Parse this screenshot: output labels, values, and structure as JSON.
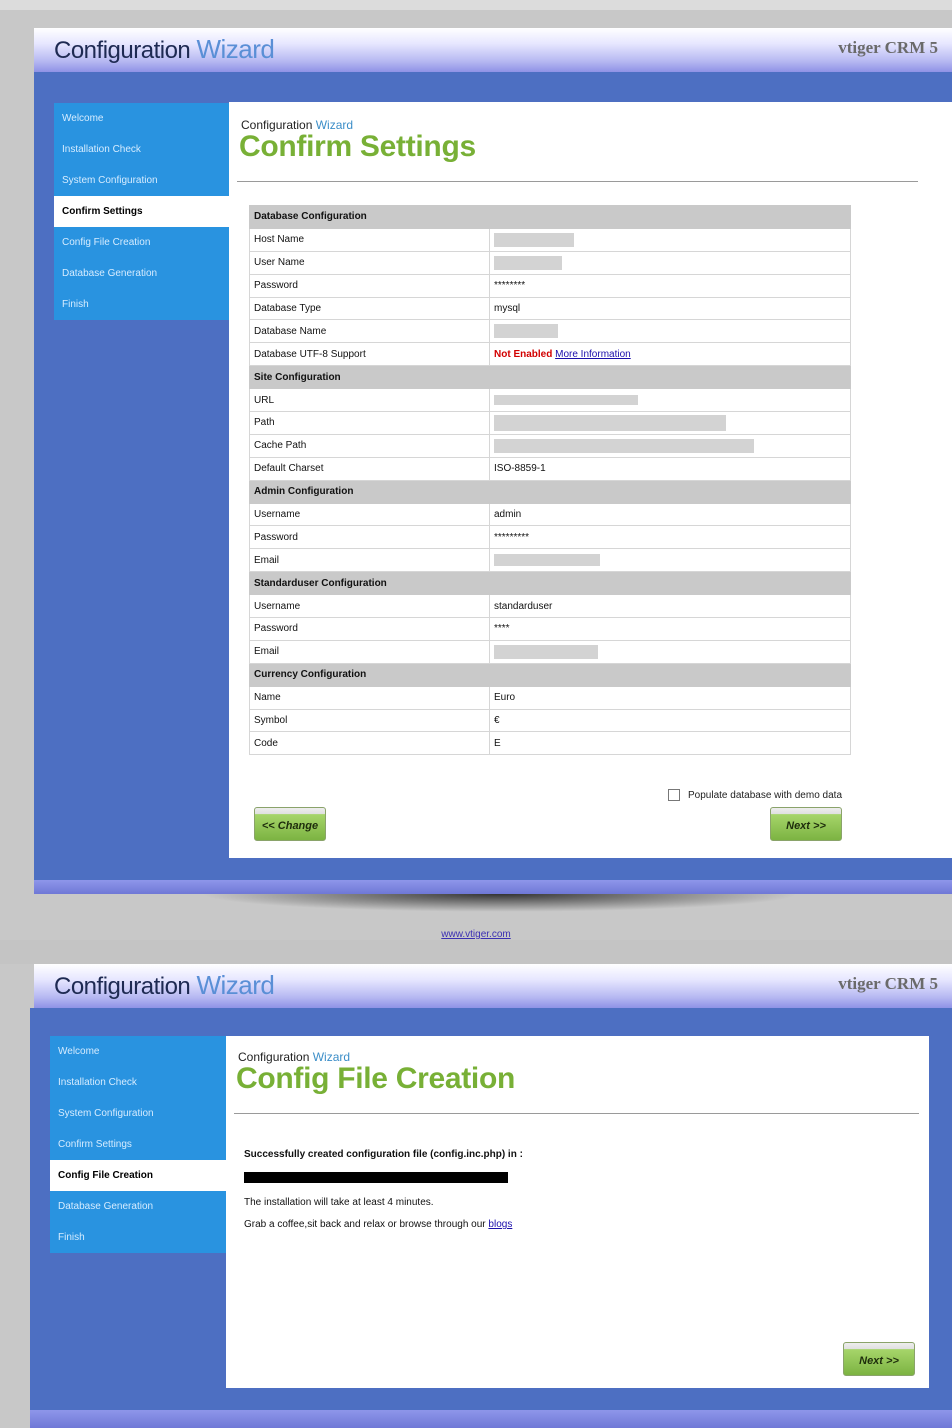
{
  "header": {
    "title_part1": "Configuration",
    "title_part2": "Wizard",
    "brand": "vtiger CRM 5"
  },
  "sidebar_confirm": {
    "items": [
      {
        "label": "Welcome"
      },
      {
        "label": "Installation Check"
      },
      {
        "label": "System Configuration"
      },
      {
        "label": "Confirm Settings",
        "active": true
      },
      {
        "label": "Config File Creation"
      },
      {
        "label": "Database Generation"
      },
      {
        "label": "Finish"
      }
    ]
  },
  "confirm": {
    "small_title_part1": "Configuration",
    "small_title_part2": "Wizard",
    "title": "Confirm Settings",
    "sections": [
      {
        "title": "Database Configuration",
        "rows": [
          {
            "label": "Host Name",
            "value": ""
          },
          {
            "label": "User Name",
            "value": ""
          },
          {
            "label": "Password",
            "value": "********"
          },
          {
            "label": "Database Type",
            "value": "mysql"
          },
          {
            "label": "Database Name",
            "value": ""
          },
          {
            "label": "Database UTF-8 Support",
            "value": "Not Enabled",
            "link": "More Information"
          }
        ]
      },
      {
        "title": "Site Configuration",
        "rows": [
          {
            "label": "URL",
            "value": ""
          },
          {
            "label": "Path",
            "value": ""
          },
          {
            "label": "Cache Path",
            "value": ""
          },
          {
            "label": "Default Charset",
            "value": "ISO-8859-1"
          }
        ]
      },
      {
        "title": "Admin Configuration",
        "rows": [
          {
            "label": "Username",
            "value": "admin"
          },
          {
            "label": "Password",
            "value": "*********"
          },
          {
            "label": "Email",
            "value": ""
          }
        ]
      },
      {
        "title": "Standarduser Configuration",
        "rows": [
          {
            "label": "Username",
            "value": "standarduser"
          },
          {
            "label": "Password",
            "value": "****"
          },
          {
            "label": "Email",
            "value": ""
          }
        ]
      },
      {
        "title": "Currency Configuration",
        "rows": [
          {
            "label": "Name",
            "value": "Euro"
          },
          {
            "label": "Symbol",
            "value": "€"
          },
          {
            "label": "Code",
            "value": "E"
          }
        ]
      }
    ],
    "demo_label": "Populate database with demo data",
    "change_button": "<< Change",
    "next_button": "Next >>"
  },
  "footer": {
    "link": "www.vtiger.com"
  },
  "sidebar_config": {
    "items": [
      {
        "label": "Welcome"
      },
      {
        "label": "Installation Check"
      },
      {
        "label": "System Configuration"
      },
      {
        "label": "Confirm Settings"
      },
      {
        "label": "Config File Creation",
        "active": true
      },
      {
        "label": "Database Generation"
      },
      {
        "label": "Finish"
      }
    ]
  },
  "configfile": {
    "small_title_part1": "Configuration",
    "small_title_part2": "Wizard",
    "title": "Config File Creation",
    "success": "Successfully created configuration file (config.inc.php) in :",
    "wait": "The installation will take at least 4 minutes.",
    "grab": "Grab a coffee,sit back and relax or browse through our",
    "blogs_link": "blogs",
    "next_button": "Next >>"
  }
}
